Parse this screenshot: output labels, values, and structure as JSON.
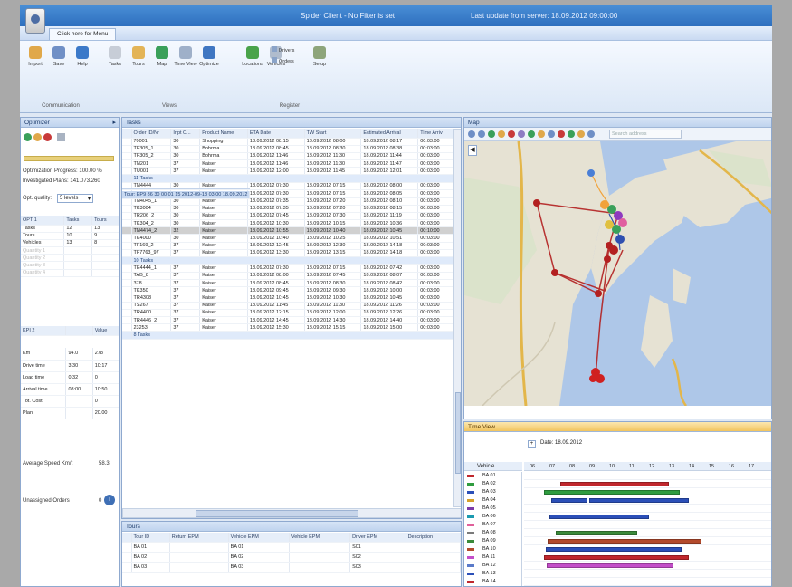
{
  "titlebar": {
    "title": "Spider Client - No Filter is set",
    "update_status": "Last update from server: 18.09.2012 09:00:00"
  },
  "menu": {
    "tab_label": "Click here for Menu"
  },
  "ribbon": {
    "buttons": [
      {
        "label": "Import",
        "icon": "folder-icon",
        "color": "#e0a84a"
      },
      {
        "label": "Save",
        "icon": "save-icon",
        "color": "#6f8fc6"
      },
      {
        "label": "Help",
        "icon": "help-icon",
        "color": "#3b79c9"
      },
      {
        "label": "Tasks",
        "icon": "tasks-icon",
        "color": "#c7cdd7"
      },
      {
        "label": "Tours",
        "icon": "tours-icon",
        "color": "#e3b457"
      },
      {
        "label": "Map",
        "icon": "globe-icon",
        "color": "#3aa05a"
      },
      {
        "label": "Time View",
        "icon": "clock-icon",
        "color": "#9fb0c9"
      },
      {
        "label": "Optimize",
        "icon": "optimize-icon",
        "color": "#3f76c2"
      },
      {
        "label": "Locations",
        "icon": "pin-icon",
        "color": "#4aa34a"
      },
      {
        "label": "Vehicles",
        "icon": "vehicle-icon",
        "color": "#b0bccd"
      },
      {
        "label": "Setup",
        "icon": "setup-icon",
        "color": "#8ea57b"
      }
    ],
    "small_buttons": [
      "Drivers",
      "Orders"
    ],
    "groups": [
      "Communication",
      "Views",
      "Register"
    ]
  },
  "left_panel": {
    "title": "Optimizer",
    "line1": "Optimization Progress: 100.00 %",
    "line2": "Investigated Plans: 141.073.260",
    "quality_label": "Opt. quality:",
    "quality_value": "5 levels",
    "table1": {
      "headers": [
        "OPT 1",
        "Tasks",
        "Tours"
      ],
      "rows": [
        [
          "Tasks",
          "12",
          "13"
        ],
        [
          "Tours",
          "10",
          "9"
        ],
        [
          "Vehicles",
          "13",
          "8"
        ]
      ],
      "faded": [
        "Quantity 1",
        "Quantity 2",
        "Quantity 3",
        "Quantity 4"
      ]
    },
    "table2_header": [
      "KPI 2",
      "Value"
    ],
    "stats": [
      [
        "Km",
        "94.0",
        "278"
      ],
      [
        "Drive time",
        "3:30",
        "10:17"
      ],
      [
        "Load time",
        "0:32",
        "0"
      ],
      [
        "Arrival time",
        "08:00",
        "10:50"
      ],
      [
        "Tot. Cost",
        "",
        "0"
      ],
      [
        "Plan",
        "",
        "20.00"
      ]
    ],
    "avg_speed_label": "Average Speed Km/t",
    "avg_speed_value": "58.3",
    "unassigned_label": "Unassigned Orders",
    "unassigned_value": "0"
  },
  "tasks_panel": {
    "title": "Tasks",
    "columns": [
      "Order ID/Nr",
      "Inpt C...",
      "Product Name",
      "ETA Date",
      "TW Start",
      "Estimated Arrival",
      "Time Arriv"
    ],
    "group1_rows": [
      [
        "70001",
        "30",
        "Shopping",
        "18.09.2012 08:15",
        "18.09.2012 08:00",
        "18.09.2012 08:17",
        "00:03:00"
      ],
      [
        "TF305_1",
        "30",
        "Bohrma",
        "18.09.2012 08:45",
        "18.09.2012 08:30",
        "18.09.2012 08:38",
        "00:03:00"
      ],
      [
        "TF305_2",
        "30",
        "Bohrma",
        "18.09.2012 11:46",
        "18.09.2012 11:30",
        "18.09.2012 11:44",
        "00:03:00"
      ],
      [
        "TN201",
        "37",
        "Kaiser",
        "18.09.2012 11:46",
        "18.09.2012 11:30",
        "18.09.2012 11:47",
        "00:03:00"
      ],
      [
        "TU001",
        "37",
        "Kaiser",
        "18.09.2012 12:00",
        "18.09.2012 11:45",
        "18.09.2012 12:01",
        "00:03:00"
      ]
    ],
    "group1_count": "11 Tasks",
    "group2_header": "Tour: EP8  86  30  00 01 15  2012-09-18 03:00  18.09.2012",
    "group2_rows": [
      [
        "TN4444",
        "30",
        "Kaiser",
        "18.09.2012 07:30",
        "18.09.2012 07:15",
        "18.09.2012 08:00",
        "00:03:00"
      ],
      [
        "TN304_1",
        "30",
        "Kaiser",
        "18.09.2012 07:30",
        "18.09.2012 07:15",
        "18.09.2012 08:05",
        "00:03:00"
      ],
      [
        "TN4045_1",
        "30",
        "Kaiser",
        "18.09.2012 07:35",
        "18.09.2012 07:20",
        "18.09.2012 08:10",
        "00:03:00"
      ],
      [
        "TK3004",
        "30",
        "Kaiser",
        "18.09.2012 07:35",
        "18.09.2012 07:20",
        "18.09.2012 08:15",
        "00:03:00"
      ],
      [
        "TR206_2",
        "30",
        "Kaiser",
        "18.09.2012 07:45",
        "18.09.2012 07:30",
        "18.09.2012 11:19",
        "00:03:00"
      ],
      [
        "TK304_2",
        "30",
        "Kaiser",
        "18.09.2012 10:30",
        "18.09.2012 10:15",
        "18.09.2012 10:36",
        "00:03:00"
      ],
      [
        "TN4474_2",
        "32",
        "Kaiser",
        "18.09.2012 10:55",
        "18.09.2012 10:40",
        "18.09.2012 10:45",
        "00:10:00"
      ],
      [
        "TK4000",
        "30",
        "Kaiser",
        "18.09.2012 10:40",
        "18.09.2012 10:25",
        "18.09.2012 10:51",
        "00:03:00"
      ],
      [
        "TF169_2",
        "37",
        "Kaiser",
        "18.09.2012 12:45",
        "18.09.2012 12:30",
        "18.09.2012 14:18",
        "00:03:00"
      ],
      [
        "TF7763_97",
        "37",
        "Kaiser",
        "18.09.2012 13:30",
        "18.09.2012 13:15",
        "18.09.2012 14:18",
        "00:03:00"
      ]
    ],
    "group2_count": "10 Tasks",
    "group3_header": "Tour: EP9  86  30  00 01 15  2012-09-18 03:00  18.09.2012",
    "group3_rows": [
      [
        "TE4444_1",
        "37",
        "Kaiser",
        "18.09.2012 07:30",
        "18.09.2012 07:15",
        "18.09.2012 07:42",
        "00:03:00"
      ],
      [
        "TAB_8",
        "37",
        "Kaiser",
        "18.09.2012 08:00",
        "18.09.2012 07:45",
        "18.09.2012 08:07",
        "00:03:00"
      ],
      [
        "378",
        "37",
        "Kaiser",
        "18.09.2012 08:45",
        "18.09.2012 08:30",
        "18.09.2012 08:42",
        "00:03:00"
      ],
      [
        "TK350",
        "37",
        "Kaiser",
        "18.09.2012 09:45",
        "18.09.2012 09:30",
        "18.09.2012 10:00",
        "00:03:00"
      ],
      [
        "TR4308",
        "37",
        "Kaiser",
        "18.09.2012 10:45",
        "18.09.2012 10:30",
        "18.09.2012 10:45",
        "00:03:00"
      ],
      [
        "TS267",
        "37",
        "Kaiser",
        "18.09.2012 11:45",
        "18.09.2012 11:30",
        "18.09.2012 11:26",
        "00:03:00"
      ],
      [
        "TR4400",
        "37",
        "Kaiser",
        "18.09.2012 12:15",
        "18.09.2012 12:00",
        "18.09.2012 12:26",
        "00:03:00"
      ],
      [
        "TR4446_2",
        "37",
        "Kaiser",
        "18.09.2012 14:45",
        "18.09.2012 14:30",
        "18.09.2012 14:40",
        "00:03:00"
      ],
      [
        "23253",
        "37",
        "Kaiser",
        "18.09.2012 15:30",
        "18.09.2012 15:15",
        "18.09.2012 15:00",
        "00:03:00"
      ]
    ],
    "group3_count": "8 Tasks"
  },
  "tours_panel": {
    "title": "Tours",
    "columns": [
      "Tour ID",
      "Return EPM",
      "Vehicle EPM",
      "Vehicle EPM",
      "Driver EPM",
      "Description"
    ],
    "rows": [
      [
        "BA 01",
        "",
        "BA 01",
        "",
        "S01",
        ""
      ],
      [
        "BA 02",
        "",
        "BA 02",
        "",
        "S02",
        ""
      ],
      [
        "BA 03",
        "",
        "BA 03",
        "",
        "S03",
        ""
      ]
    ]
  },
  "map_panel": {
    "title": "Map",
    "search_placeholder": "Search address"
  },
  "timeview_panel": {
    "title": "Time View",
    "date_label": "Date: 18.09.2012",
    "vehicle_header": "Vehicle",
    "vehicles": [
      {
        "name": "BA 01",
        "color": "#c0272d"
      },
      {
        "name": "BA 02",
        "color": "#2f9c3f"
      },
      {
        "name": "BA 03",
        "color": "#2b4fb8"
      },
      {
        "name": "BA 04",
        "color": "#d6a12a"
      },
      {
        "name": "BA 05",
        "color": "#7c3ba8"
      },
      {
        "name": "BA 06",
        "color": "#1b9ab0"
      },
      {
        "name": "BA 07",
        "color": "#e0609a"
      },
      {
        "name": "BA 08",
        "color": "#7a7a7a"
      },
      {
        "name": "BA 09",
        "color": "#3a8a3a"
      },
      {
        "name": "BA 10",
        "color": "#b34a2c"
      },
      {
        "name": "BA 11",
        "color": "#c34ec9"
      },
      {
        "name": "BA 12",
        "color": "#5a7ac9"
      },
      {
        "name": "BA 13",
        "color": "#2b4fb8"
      },
      {
        "name": "BA 14",
        "color": "#c0272d"
      }
    ],
    "hours": [
      "06",
      "07",
      "08",
      "09",
      "10",
      "11",
      "12",
      "13",
      "14",
      "15",
      "16",
      "17"
    ]
  }
}
